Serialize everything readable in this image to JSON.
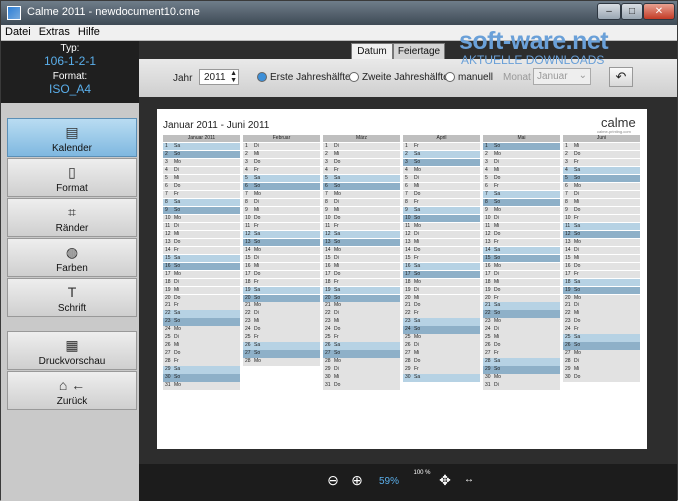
{
  "window": {
    "title": "Calme 2011 - newdocument10.cme"
  },
  "menu": [
    "Datei",
    "Extras",
    "Hilfe"
  ],
  "info": {
    "typ_label": "Typ:",
    "typ_value": "106-1-2-1",
    "format_label": "Format:",
    "format_value": "ISO_A4"
  },
  "nav": [
    {
      "label": "Kalender",
      "icon": "calendar-icon"
    },
    {
      "label": "Format",
      "icon": "format-icon"
    },
    {
      "label": "Ränder",
      "icon": "margins-icon"
    },
    {
      "label": "Farben",
      "icon": "palette-icon"
    },
    {
      "label": "Schrift",
      "icon": "font-icon"
    },
    {
      "label": "Druckvorschau",
      "icon": "print-preview-icon"
    },
    {
      "label": "Zurück",
      "icon": "back-icon"
    }
  ],
  "tabs": [
    "Datum",
    "Feiertage"
  ],
  "datebar": {
    "year_label": "Jahr",
    "year": "2011",
    "opt1": "Erste Jahreshälfte",
    "opt2": "Zweite Jahreshälfte",
    "opt3": "manuell",
    "month_label": "Monat",
    "month": "Januar"
  },
  "watermark": {
    "main": "soft-ware.net",
    "sub": "AKTUELLE DOWNLOADS"
  },
  "calendar": {
    "title": "Januar 2011 - Juni 2011",
    "logo": "calme",
    "logo_sub": "calme-printing.com",
    "months": [
      "Januar 2011",
      "Februar",
      "März",
      "April",
      "Mai",
      "Juni"
    ]
  },
  "zoom": {
    "value": "59%",
    "btn100": "100 %"
  }
}
